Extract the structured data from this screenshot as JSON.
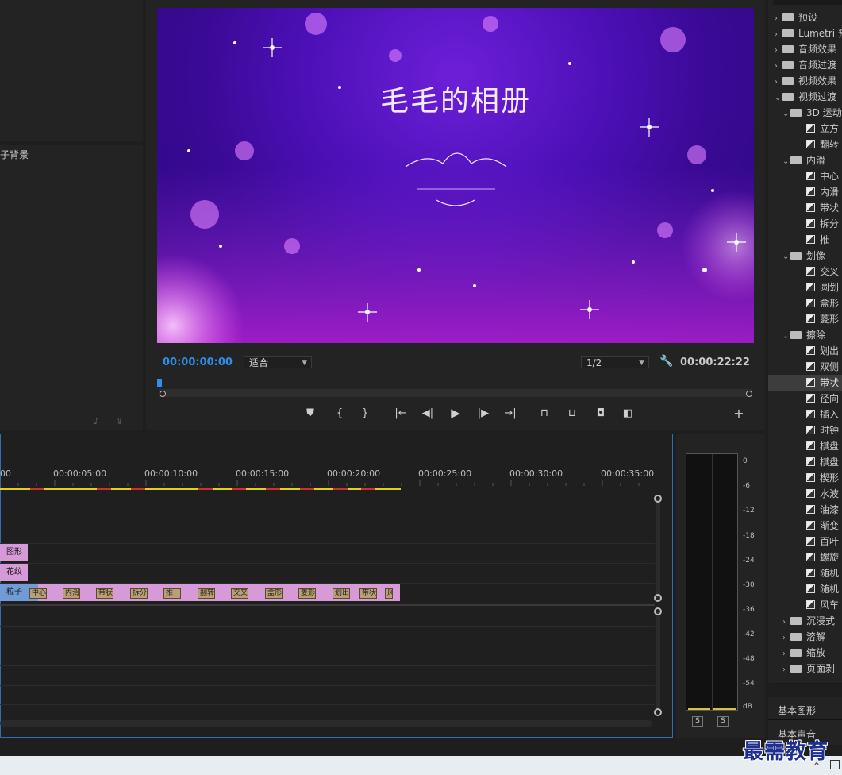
{
  "project_panel": {
    "item_label": "子背景"
  },
  "monitor": {
    "video_title": "毛毛的相册",
    "current_timecode": "00:00:00:00",
    "fit_select": "适合",
    "resolution_select": "1/2",
    "duration_timecode": "00:00:22:22",
    "controls": [
      "marker-icon",
      "mark-in-icon",
      "mark-out-icon",
      "go-to-in-icon",
      "step-back-icon",
      "play-icon",
      "step-forward-icon",
      "go-to-out-icon",
      "lift-icon",
      "extract-icon",
      "camera-icon",
      "compare-icon",
      "add-icon"
    ]
  },
  "timeline": {
    "ruler": [
      "00",
      "00:00:05:00",
      "00:00:10:00",
      "00:00:15:00",
      "00:00:20:00",
      "00:00:25:00",
      "00:00:30:00",
      "00:00:35:00"
    ],
    "clips": {
      "v3": "图形",
      "v2": "花纹",
      "v1": "粒子"
    },
    "transitions": [
      "中心",
      "内滑",
      "带状",
      "拆分",
      "推",
      "翻转",
      "交叉",
      "盒形",
      "菱形",
      "划出",
      "带状",
      "风"
    ]
  },
  "audio_meter": {
    "db_labels": [
      "0",
      "-6",
      "-12",
      "-18",
      "-24",
      "-30",
      "-36",
      "-42",
      "-48",
      "-54",
      "dB"
    ],
    "solo_left": "S",
    "solo_right": "S"
  },
  "effects": {
    "top_items": [
      {
        "label": "预设",
        "type": "folder-star",
        "expanded": false
      },
      {
        "label": "Lumetri 预",
        "type": "folder-star",
        "expanded": false
      },
      {
        "label": "音频效果",
        "type": "folder",
        "expanded": false
      },
      {
        "label": "音频过渡",
        "type": "folder",
        "expanded": false
      },
      {
        "label": "视频效果",
        "type": "folder",
        "expanded": false
      },
      {
        "label": "视频过渡",
        "type": "folder",
        "expanded": true
      }
    ],
    "groups": [
      {
        "label": "3D 运动",
        "items": [
          "立方",
          "翻转"
        ]
      },
      {
        "label": "内滑",
        "items": [
          "中心",
          "内滑",
          "带状",
          "拆分",
          "推"
        ]
      },
      {
        "label": "划像",
        "items": [
          "交叉",
          "圆划",
          "盒形",
          "菱形"
        ]
      },
      {
        "label": "擦除",
        "items": [
          "划出",
          "双侧",
          "带状",
          "径向",
          "插入",
          "时钟",
          "棋盘",
          "棋盘",
          "楔形",
          "水波",
          "油漆",
          "渐变",
          "百叶",
          "螺旋",
          "随机",
          "随机",
          "风车"
        ]
      }
    ],
    "collapsed_groups": [
      "沉浸式",
      "溶解",
      "缩放",
      "页面剥"
    ],
    "selected": "带状"
  },
  "bottom_tabs": {
    "essential_graphics": "基本图形",
    "essential_sound": "基本声音"
  },
  "watermark": "最需教育"
}
